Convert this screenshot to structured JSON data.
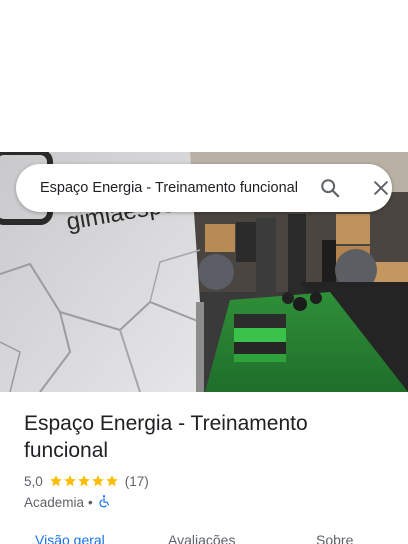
{
  "search": {
    "query": "Espaço Energia - Treinamento funcional"
  },
  "place": {
    "name": "Espaço Energia - Treinamento funcional",
    "rating": "5,0",
    "star_count": 5,
    "review_count": "(17)",
    "category": "Academia",
    "separator": "•",
    "wall_sign_text": "gimlaespersonal"
  },
  "tabs": [
    {
      "label": "Visão geral",
      "active": true
    },
    {
      "label": "Avaliações",
      "active": false
    },
    {
      "label": "Sobre",
      "active": false
    }
  ],
  "icons": {
    "search": "search-icon",
    "close": "close-icon",
    "star": "star-icon",
    "accessibility": "wheelchair-icon"
  },
  "colors": {
    "accent": "#1a73e8",
    "star": "#fbbc04",
    "text": "#202124",
    "secondary_text": "#5f6368",
    "turf": "#2e8b3a"
  }
}
